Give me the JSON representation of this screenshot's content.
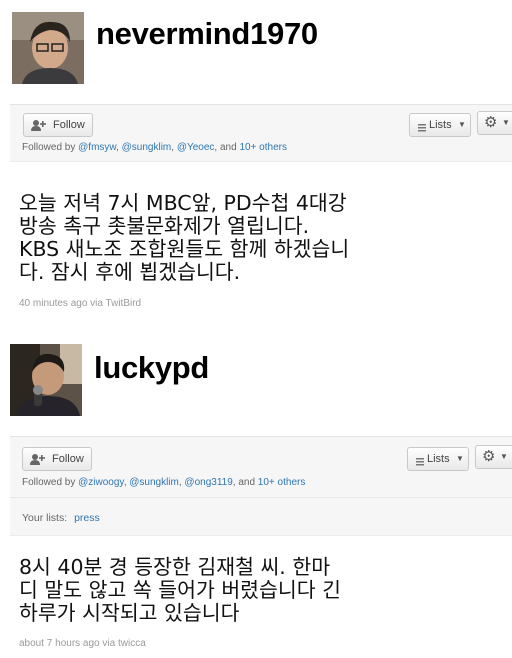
{
  "profiles": [
    {
      "username": "nevermind1970",
      "follow_label": "Follow",
      "lists_label": "Lists",
      "followed_prefix": "Followed by",
      "followers": [
        "@fmsyw",
        "@sungklim",
        "@Yeoec"
      ],
      "and_label": "and",
      "others_label": "10+ others",
      "tweet": "오늘 저녁 7시 MBC앞, PD수첩 4대강\n방송 촉구 촛불문화제가 열립니다.\nKBS 새노조 조합원들도 함께 하겠습니\n다. 잠시 후에 뵙겠습니다.",
      "time": "40 minutes ago",
      "via": "via TwitBird"
    },
    {
      "username": "luckypd",
      "follow_label": "Follow",
      "lists_label": "Lists",
      "followed_prefix": "Followed by",
      "followers": [
        "@ziwoogy",
        "@sungklim",
        "@ong3119"
      ],
      "and_label": "and",
      "others_label": "10+ others",
      "your_lists_label": "Your lists:",
      "your_lists_value": "press",
      "tweet": "8시 40분 경 등장한 김재철 씨. 한마\n디 말도 않고 쏙 들어가 버렸습니다 긴\n하루가 시작되고 있습니다",
      "time": "about 7 hours ago",
      "via": "via twicca"
    }
  ],
  "icons": {
    "follow": "person-plus-icon",
    "lists": "list-icon",
    "settings": "gear-icon",
    "dropdown": "caret-down-icon"
  }
}
